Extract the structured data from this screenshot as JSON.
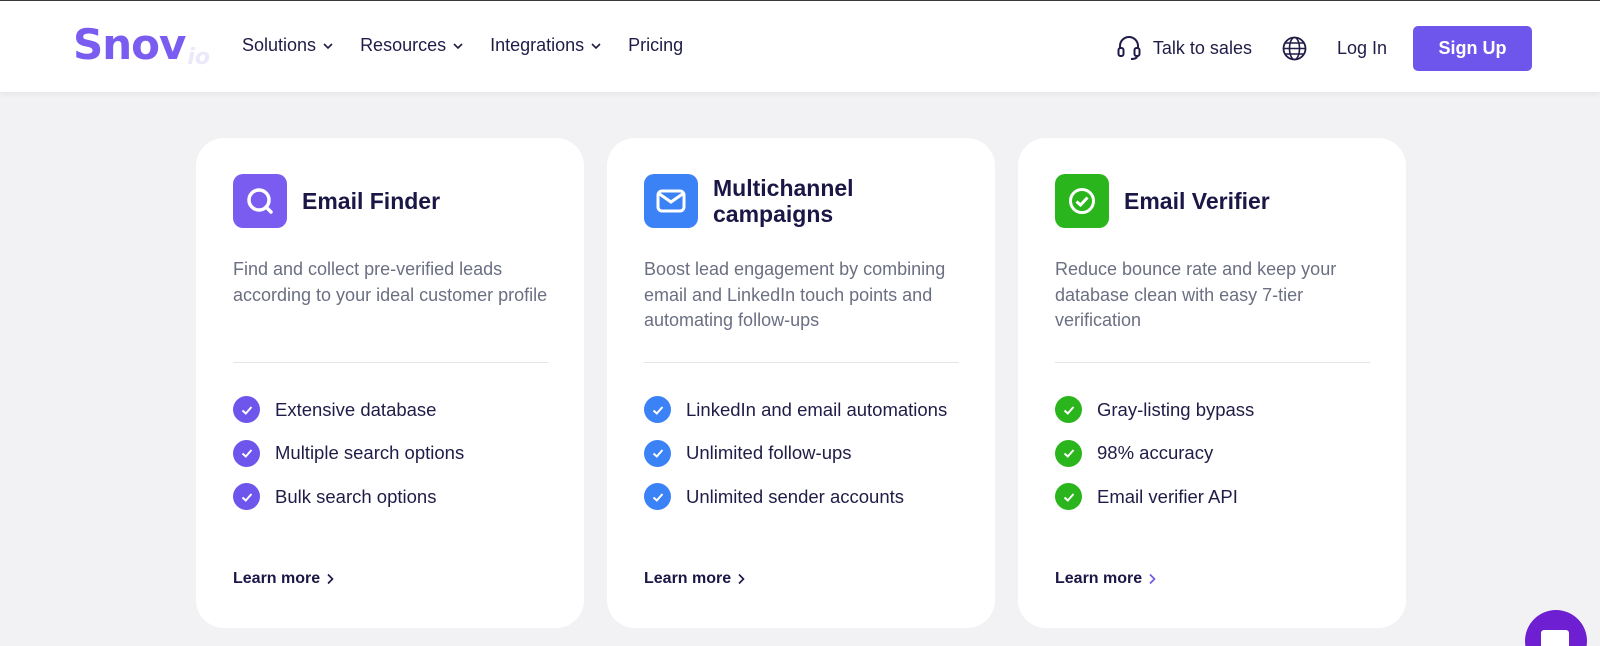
{
  "header": {
    "logo_main": "Snov",
    "logo_sub": "io",
    "nav": [
      "Solutions",
      "Resources",
      "Integrations",
      "Pricing"
    ],
    "talk_to_sales": "Talk to sales",
    "log_in": "Log In",
    "sign_up": "Sign Up"
  },
  "colors": {
    "brand_purple": "#6e55eb",
    "blue": "#3b82f6",
    "green": "#2bb51c"
  },
  "cards": [
    {
      "title_line1": "Email Finder",
      "title_line2": "",
      "icon": "search-icon",
      "description": "Find and collect pre-verified leads according to your ideal customer profile",
      "features": [
        "Extensive database",
        "Multiple search options",
        "Bulk search options"
      ],
      "learn_more": "Learn more"
    },
    {
      "title_line1": "Multichannel",
      "title_line2": "campaigns",
      "icon": "envelope-icon",
      "description": "Boost lead engagement by combining email and LinkedIn touch points and automating follow-ups",
      "features": [
        "LinkedIn and email automations",
        "Unlimited follow-ups",
        "Unlimited sender accounts"
      ],
      "learn_more": "Learn more"
    },
    {
      "title_line1": "Email Verifier",
      "title_line2": "",
      "icon": "check-circle-icon",
      "description": "Reduce bounce rate and keep your database clean with easy 7-tier verification",
      "features": [
        "Gray-listing bypass",
        "98% accuracy",
        "Email verifier API"
      ],
      "learn_more": "Learn more"
    }
  ]
}
